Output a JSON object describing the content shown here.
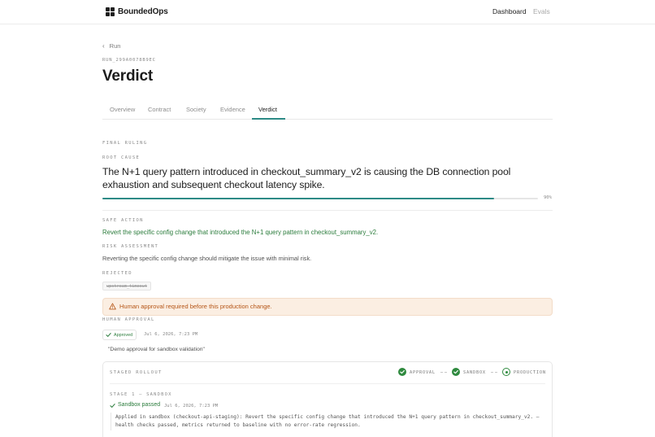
{
  "header": {
    "brand": "BoundedOps",
    "nav": [
      {
        "label": "Dashboard",
        "active": true
      },
      {
        "label": "Evals",
        "active": false
      }
    ]
  },
  "page": {
    "back_label": "Run",
    "run_id": "RUN_299A0078B9EC",
    "title": "Verdict"
  },
  "tabs": [
    {
      "label": "Overview"
    },
    {
      "label": "Contract"
    },
    {
      "label": "Society"
    },
    {
      "label": "Evidence"
    },
    {
      "label": "Verdict",
      "active": true
    }
  ],
  "verdict": {
    "final_ruling_label": "FINAL RULING",
    "root_cause_label": "ROOT CAUSE",
    "root_cause": "The N+1 query pattern introduced in checkout_summary_v2 is causing the DB connection pool exhaustion and subsequent checkout latency spike.",
    "confidence": 0.9,
    "confidence_text": "90%",
    "safe_action_label": "SAFE ACTION",
    "safe_action": "Revert the specific config change that introduced the N+1 query pattern in checkout_summary_v2.",
    "risk_label": "RISK ASSESSMENT",
    "risk": "Reverting the specific config change should mitigate the issue with minimal risk.",
    "rejected_label": "REJECTED",
    "rejected": [
      "upstream_timeout"
    ]
  },
  "warning": {
    "icon": "warning-triangle-icon",
    "text": "Human approval required before this production change."
  },
  "approval": {
    "label": "HUMAN APPROVAL",
    "status": "Approved",
    "date": "Jul 6, 2026, 7:23 PM",
    "quote": "\"Demo approval for sandbox validation\""
  },
  "rollout": {
    "label": "STAGED ROLLOUT",
    "steps": [
      {
        "label": "APPROVAL",
        "state": "done"
      },
      {
        "label": "SANDBOX",
        "state": "done"
      },
      {
        "label": "PRODUCTION",
        "state": "current"
      }
    ],
    "stage_label": "STAGE 1 — SANDBOX",
    "status": "Sandbox passed",
    "status_date": "Jul 6, 2026, 7:23 PM",
    "detail": "Applied in sandbox (checkout-api-staging): Revert the specific config change that introduced the N+1 query pattern in checkout_summary_v2. — health checks passed, metrics returned to baseline with no error-rate regression."
  },
  "colors": {
    "accent": "#2d8a86",
    "success": "#2b7c3c",
    "warning_text": "#b55516",
    "warning_bg": "#fbeee2"
  }
}
